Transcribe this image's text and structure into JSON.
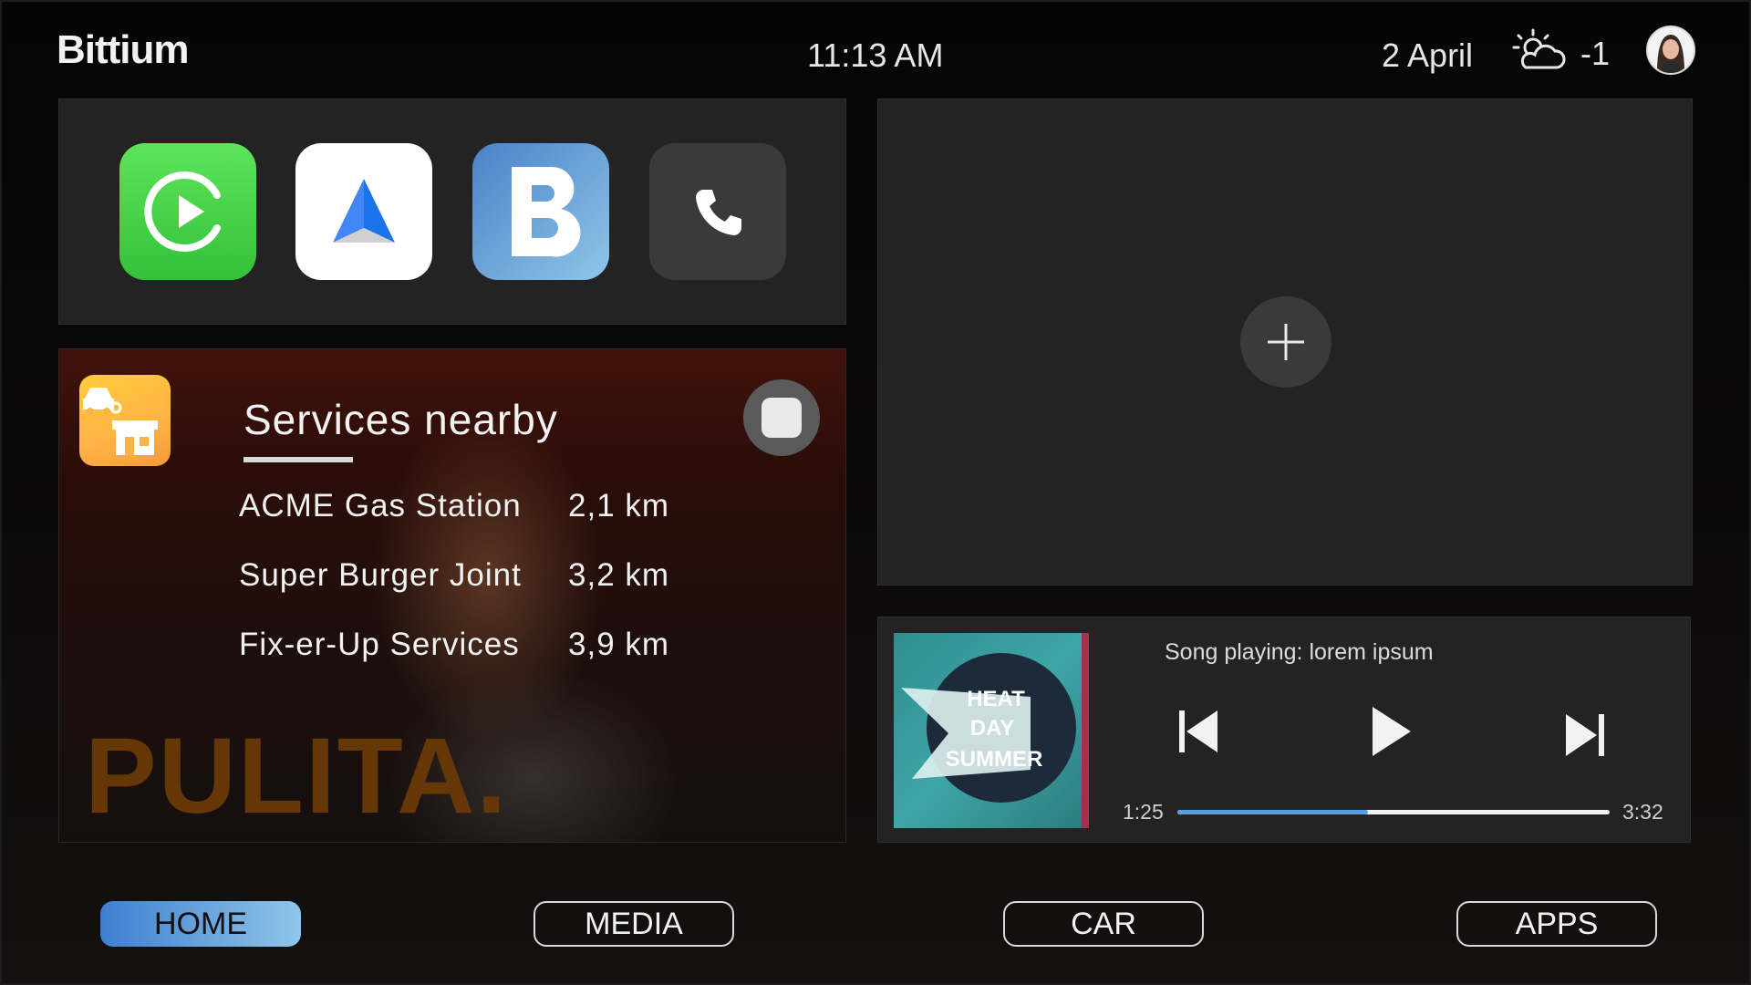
{
  "header": {
    "brand": "Bittium",
    "time": "11:13 AM",
    "date": "2 April",
    "weather_icon": "partly-cloudy-sun-icon",
    "temperature": "-1"
  },
  "app_shortcuts": [
    {
      "name": "CarPlay",
      "icon": "carplay-icon",
      "color": "#4cd24c"
    },
    {
      "name": "Android Auto",
      "icon": "android-auto-icon",
      "color": "#ffffff"
    },
    {
      "name": "B",
      "icon": "b-app-icon",
      "color": "#5c95d4"
    },
    {
      "name": "Phone",
      "icon": "phone-icon",
      "color": "#3a3a3a"
    }
  ],
  "services": {
    "title": "Services nearby",
    "watermark": "PULITA.",
    "items": [
      {
        "name": "ACME Gas Station",
        "distance": "2,1 km"
      },
      {
        "name": "Super Burger Joint",
        "distance": "3,2 km"
      },
      {
        "name": "Fix-er-Up Services",
        "distance": "3,9 km"
      }
    ]
  },
  "media": {
    "song_label": "Song playing: lorem ipsum",
    "album_text": [
      "HEAT",
      "DAY",
      "SUMMER"
    ],
    "elapsed": "1:25",
    "duration": "3:32",
    "progress": 0.44
  },
  "nav": {
    "home": "HOME",
    "media": "MEDIA",
    "car": "CAR",
    "apps": "APPS",
    "active": "home",
    "active_gradient": [
      "#3f7fd0",
      "#8fc6e8"
    ]
  }
}
